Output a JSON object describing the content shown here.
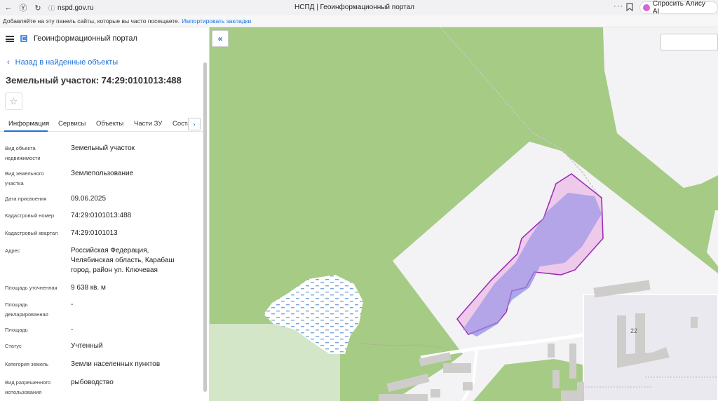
{
  "browser": {
    "url": "nspd.gov.ru",
    "title": "НСПД | Геоинформационный портал",
    "alice_label": "Спросить Алису AI",
    "bookmarks_hint": "Добавляйте на эту панель сайты, которые вы часто посещаете.",
    "bookmarks_import": "Импортировать закладки"
  },
  "header": {
    "title": "Геоинформационный портал"
  },
  "nav": {
    "back_label": "Назад в найденные объекты"
  },
  "page": {
    "title": "Земельный участок: 74:29:0101013:488"
  },
  "tabs": [
    "Информация",
    "Сервисы",
    "Объекты",
    "Части ЗУ",
    "Соста"
  ],
  "fields": [
    {
      "label": "Вид объекта недвижимости",
      "value": "Земельный участок"
    },
    {
      "label": "Вид земельного участка",
      "value": "Землепользование"
    },
    {
      "label": "Дата присвоения",
      "value": "09.06.2025"
    },
    {
      "label": "Кадастровый номер",
      "value": "74:29:0101013:488"
    },
    {
      "label": "Кадастровый квартал",
      "value": "74:29:0101013"
    },
    {
      "label": "Адрес",
      "value": "Российская Федерация, Челябинская область, Карабаш город, район ул. Ключевая"
    },
    {
      "label": "Площадь уточненная",
      "value": "9 638 кв. м"
    },
    {
      "label": "Площадь декларированная",
      "value": "-"
    },
    {
      "label": "Площадь",
      "value": "-"
    },
    {
      "label": "Статус",
      "value": "Учтенный"
    },
    {
      "label": "Категория земель",
      "value": "Земли населенных пунктов"
    },
    {
      "label": "Вид разрешенного использования",
      "value": "рыбоводство"
    }
  ],
  "map": {
    "building_number": "22"
  },
  "colors": {
    "accent": "#1e6fd9",
    "forest": "#a5cb85",
    "parcel_stroke": "#9c2fb5"
  }
}
